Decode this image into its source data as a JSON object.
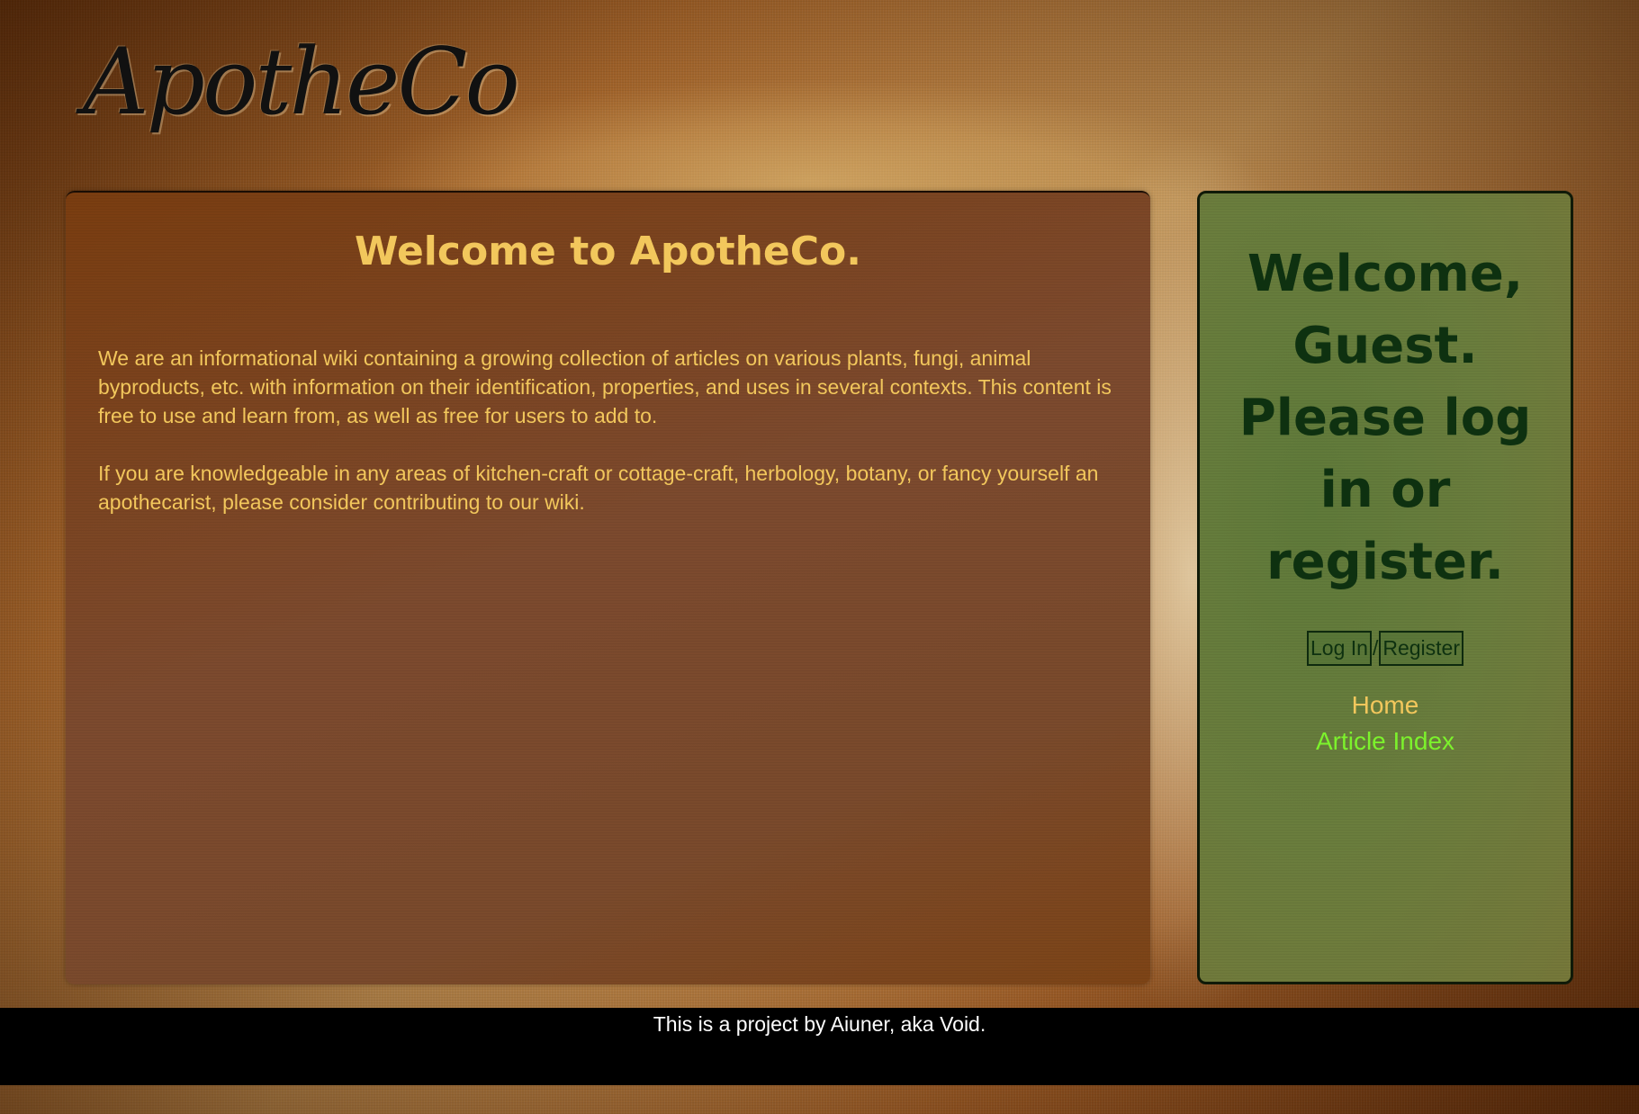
{
  "header": {
    "logo_text": "ApotheCo"
  },
  "main": {
    "title": "Welcome to ApotheCo.",
    "paragraphs": [
      "We are an informational wiki containing a growing collection of articles on various plants, fungi, animal byproducts, etc. with information on their identification, properties, and uses in several contexts. This content is free to use and learn from, as well as free for users to add to.",
      "If you are knowledgeable in any areas of kitchen-craft or cottage-craft, herbology, botany, or fancy yourself an apothecarist, please consider contributing to our wiki."
    ]
  },
  "sidebar": {
    "welcome": "Welcome, Guest. Please log in or register.",
    "login_label": "Log In",
    "separator": "/",
    "register_label": "Register",
    "nav": [
      {
        "label": "Home"
      },
      {
        "label": "Article Index"
      }
    ]
  },
  "footer": {
    "text": "This is a project by Aiuner, aka Void."
  },
  "colors": {
    "heading_gold": "#f2c75c",
    "sidebar_heading_green": "#0e3110",
    "active_link_green": "#7cf22c",
    "footer_bg": "#000000"
  }
}
